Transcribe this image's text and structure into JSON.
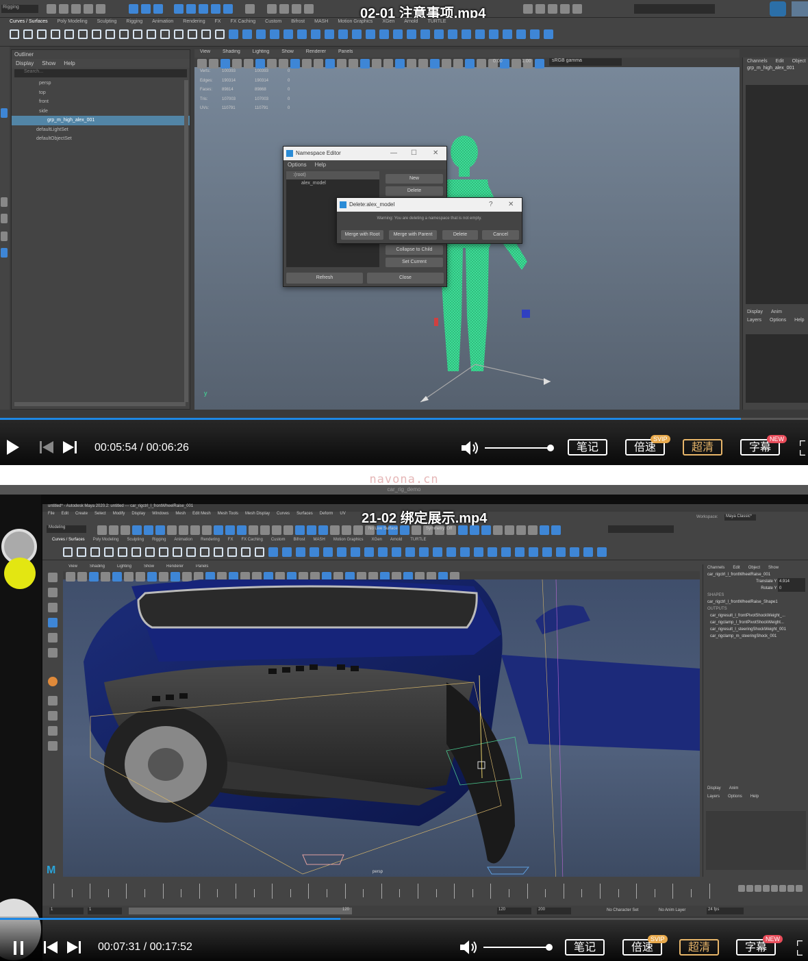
{
  "watermark": "navona.cn",
  "video1": {
    "title": "02-01 注意事项.mp4",
    "app_menubar": "Rigging",
    "shelf_tabs": [
      "Curves / Surfaces",
      "Poly Modeling",
      "Sculpting",
      "Rigging",
      "Animation",
      "Rendering",
      "FX",
      "FX Caching",
      "Custom",
      "Bifrost",
      "MASH",
      "Motion Graphics",
      "XGen",
      "Arnold",
      "TURTLE"
    ],
    "outliner": {
      "title": "Outliner",
      "menu": [
        "Display",
        "Show",
        "Help"
      ],
      "search_placeholder": "Search...",
      "items": [
        "persp",
        "top",
        "front",
        "side",
        "grp_m_high_alex_001",
        "defaultLightSet",
        "defaultObjectSet"
      ]
    },
    "viewport_menu": [
      "View",
      "Shading",
      "Lighting",
      "Show",
      "Renderer",
      "Panels"
    ],
    "gamma_value": "sRGB gamma",
    "exposure": "0.00",
    "gamma": "1.00",
    "hud_stats": [
      {
        "label": "Verts:",
        "a": "100393",
        "b": "100393",
        "c": "0"
      },
      {
        "label": "Edges:",
        "a": "190314",
        "b": "190314",
        "c": "0"
      },
      {
        "label": "Faces:",
        "a": "89814",
        "b": "89868",
        "c": "0"
      },
      {
        "label": "Tris:",
        "a": "107003",
        "b": "107003",
        "c": "0"
      },
      {
        "label": "UVs:",
        "a": "110791",
        "b": "110791",
        "c": "0"
      }
    ],
    "namespace_editor": {
      "title": "Namespace Editor",
      "menu": [
        "Options",
        "Help"
      ],
      "tree": [
        ":(root)",
        "alex_model"
      ],
      "buttons": [
        "New",
        "Delete",
        "Collapse to Child",
        "Set Current"
      ],
      "bottom_buttons": [
        "Refresh",
        "Close"
      ]
    },
    "delete_dialog": {
      "title": "Delete:alex_model",
      "help": "?",
      "warning": "Warning: You are deleting a namespace that is not empty.",
      "buttons": [
        "Merge with Root",
        "Merge with Parent",
        "Delete",
        "Cancel"
      ]
    },
    "channel_box": {
      "menu": [
        "Channels",
        "Edit",
        "Object"
      ],
      "object": "grp_m_high_alex_001",
      "layer_tabs": [
        "Display",
        "Anim"
      ],
      "layer_menu": [
        "Layers",
        "Options",
        "Help"
      ]
    },
    "player": {
      "current_time": "00:05:54",
      "total_time": "00:06:26",
      "progress": 0.917,
      "volume": 1.0,
      "buttons": {
        "notes": "笔记",
        "speed": "倍速",
        "quality": "超清",
        "subtitle": "字幕"
      },
      "badges": {
        "svip": "SVIP",
        "new": "NEW"
      }
    }
  },
  "video2": {
    "title": "21-02 绑定展示.mp4",
    "window_title": "car_rig_demo",
    "maya_title": "untitled* - Autodesk Maya 2020.2: untitled --- car_rigctrl_l_frontWheelRaise_001",
    "top_menu": [
      "File",
      "Edit",
      "Create",
      "Select",
      "Modify",
      "Display",
      "Windows",
      "Mesh",
      "Edit Mesh",
      "Mesh Tools",
      "Mesh Display",
      "Curves",
      "Surfaces",
      "Deform",
      "UV"
    ],
    "mode": "Modeling",
    "symmetry": "Symmetry: Off",
    "no_live": "No Live Surface",
    "workspace_label": "Workspace:",
    "workspace": "Maya Classic*",
    "shelf_tabs": [
      "Curves / Surfaces",
      "Poly Modeling",
      "Sculpting",
      "Rigging",
      "Animation",
      "Rendering",
      "FX",
      "FX Caching",
      "Custom",
      "Bifrost",
      "MASH",
      "Motion Graphics",
      "XGen",
      "Arnold",
      "TURTLE"
    ],
    "viewport_menu": [
      "View",
      "Shading",
      "Lighting",
      "Show",
      "Renderer",
      "Panels"
    ],
    "camera_label": "persp",
    "channel_box": {
      "menu": [
        "Channels",
        "Edit",
        "Object",
        "Show"
      ],
      "object": "car_rigctrl_l_frontWheelRaise_001",
      "attrs": [
        {
          "name": "Translate Y",
          "value": "4.914"
        },
        {
          "name": "Rotate Y",
          "value": "0"
        }
      ],
      "shapes_header": "SHAPES",
      "shape": "car_rigctrl_l_frontWheelRaise_Shape1",
      "outputs_header": "OUTPUTS",
      "outputs": [
        "car_rigresult_l_frontPivotShockWeight_...",
        "car_rigclamp_l_frontPivotShockWeight...",
        "car_rigresult_l_steeringShockWeight_001",
        "car_rigclamp_m_steeringShock_001"
      ],
      "layer_tabs": [
        "Display",
        "Anim"
      ],
      "layer_menu": [
        "Layers",
        "Options",
        "Help"
      ]
    },
    "range": {
      "start": "1",
      "start2": "1",
      "end_inner": "120",
      "end": "120",
      "end2": "200"
    },
    "char_set": "No Character Set",
    "anim_layer": "No Anim Layer",
    "fps": "24 fps",
    "player": {
      "current_time": "00:07:31",
      "total_time": "00:17:52",
      "progress": 0.421,
      "volume": 1.0,
      "buttons": {
        "notes": "笔记",
        "speed": "倍速",
        "quality": "超清",
        "subtitle": "字幕"
      },
      "badges": {
        "svip": "SVIP",
        "new": "NEW"
      }
    }
  },
  "colors": {
    "accent": "#1e88e5",
    "gold": "#e8b66a",
    "badge_svip": "#e8a94c",
    "badge_new": "#e84c5a",
    "model_green": "#3fe39a"
  }
}
